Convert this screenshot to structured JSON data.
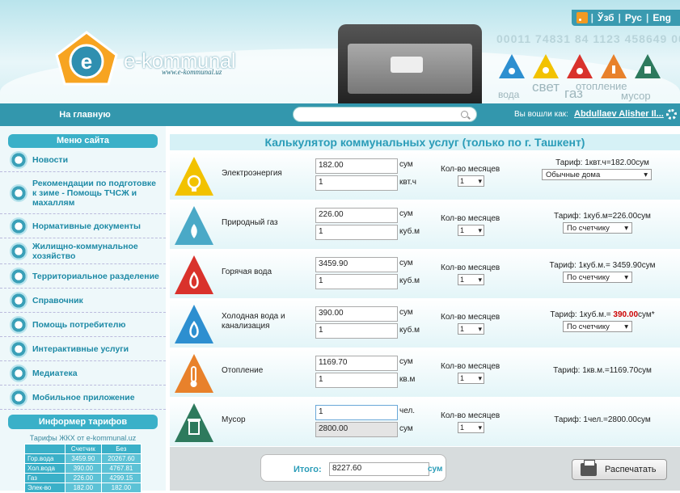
{
  "topbar": {
    "lang_uz": "Ўзб",
    "lang_ru": "Рус",
    "lang_en": "Eng"
  },
  "brand": {
    "name": "e-kommunal",
    "url": "www.e-kommunal.uz"
  },
  "header_numbers": "00011 74831 84 1123 458649 00011 74831 46 1123",
  "header_words": {
    "water": "вода",
    "light": "свет",
    "gas": "газ",
    "heating": "отопление",
    "trash": "мусор"
  },
  "nav": {
    "home": "На главную",
    "search_placeholder": "",
    "login_label": "Вы вошли как:",
    "login_user": "Abdullaev Alisher Il..."
  },
  "sidebar": {
    "menu_title": "Меню сайта",
    "items": [
      {
        "label": "Новости"
      },
      {
        "label": "Рекомендации по подготовке к зиме - Помощь ТЧСЖ и махаллям"
      },
      {
        "label": "Нормативные документы"
      },
      {
        "label": "Жилищно-коммунальное хозяйство"
      },
      {
        "label": "Территориальное разделение"
      },
      {
        "label": "Справочник"
      },
      {
        "label": "Помощь потребителю"
      },
      {
        "label": "Интерактивные услуги"
      },
      {
        "label": "Медиатека"
      },
      {
        "label": "Мобильное приложение"
      }
    ],
    "informer_title": "Информер тарифов",
    "informer_caption": "Тарифы ЖКХ от e-kommunal.uz",
    "informer_headers": [
      "",
      "Счетчик",
      "Без"
    ],
    "informer_rows": [
      [
        "Гор.вода",
        "3459.90",
        "20267.60"
      ],
      [
        "Хол.вода",
        "390.00",
        "4767.81"
      ],
      [
        "Газ",
        "226.00",
        "4299.15"
      ],
      [
        "Элек-во",
        "182.00",
        "182.00"
      ]
    ]
  },
  "calc": {
    "title": "Калькулятор коммунальных услуг (только по г. Ташкент)",
    "months_label": "Кол-во месяцев",
    "rows": [
      {
        "name": "Электроэнергия",
        "v1": "182.00",
        "u1": "сум",
        "v2": "1",
        "u2": "квт.ч",
        "months": "1",
        "tariff": "Тариф: 1квт.ч=182.00сум",
        "select": "Обычные дома",
        "color": "#f2c200"
      },
      {
        "name": "Природный газ",
        "v1": "226.00",
        "u1": "сум",
        "v2": "1",
        "u2": "куб.м",
        "months": "1",
        "tariff": "Тариф: 1куб.м=226.00сум",
        "select": "По счетчику",
        "color": "#4aa9c7"
      },
      {
        "name": "Горячая вода",
        "v1": "3459.90",
        "u1": "сум",
        "v2": "1",
        "u2": "куб.м",
        "months": "1",
        "tariff": "Тариф: 1куб.м.= 3459.90сум",
        "select": "По счетчику",
        "color": "#d9322c"
      },
      {
        "name": "Холодная вода и канализация",
        "v1": "390.00",
        "u1": "сум",
        "v2": "1",
        "u2": "куб.м",
        "months": "1",
        "tariff_pre": "Тариф: 1куб.м.= ",
        "tariff_red": "390.00",
        "tariff_post": "сум*",
        "select": "По счетчику",
        "color": "#2d8fd0"
      },
      {
        "name": "Отопление",
        "v1": "1169.70",
        "u1": "сум",
        "v2": "1",
        "u2": "кв.м",
        "months": "1",
        "tariff": "Тариф: 1кв.м.=1169.70сум",
        "color": "#e8812b"
      },
      {
        "name": "Мусор",
        "v1": "1",
        "u1": "чел.",
        "v2": "2800.00",
        "u2": "сум",
        "months": "1",
        "tariff": "Тариф: 1чел.=2800.00сум",
        "color": "#2e7a5d"
      }
    ],
    "total_label": "Итого:",
    "total_value": "8227.60",
    "total_unit": "сум",
    "print_label": "Распечатать"
  }
}
